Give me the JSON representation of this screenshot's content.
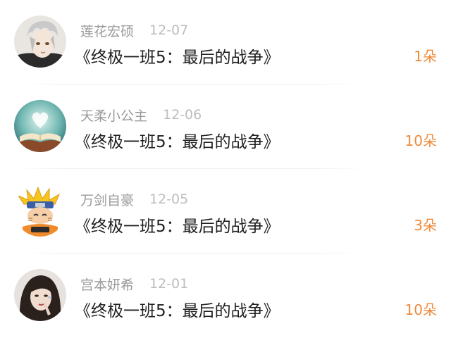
{
  "items": [
    {
      "user": "莲花宏硕",
      "date": "12-07",
      "title": "《终极一班5：最后的战争》",
      "count": "1朵",
      "avatar_icon": "anime-boy-avatar"
    },
    {
      "user": "天柔小公主",
      "date": "12-06",
      "title": "《终极一班5：最后的战争》",
      "count": "10朵",
      "avatar_icon": "heart-book-avatar"
    },
    {
      "user": "万剑自豪",
      "date": "12-05",
      "title": "《终极一班5：最后的战争》",
      "count": "3朵",
      "avatar_icon": "naruto-avatar"
    },
    {
      "user": "宫本妍希",
      "date": "12-01",
      "title": "《终极一班5：最后的战争》",
      "count": "10朵",
      "avatar_icon": "girl-portrait-avatar"
    }
  ],
  "colors": {
    "username": "#9a9a9a",
    "date": "#bdbdbd",
    "title": "#1f1f1f",
    "count_accent": "#ef8a3a"
  }
}
